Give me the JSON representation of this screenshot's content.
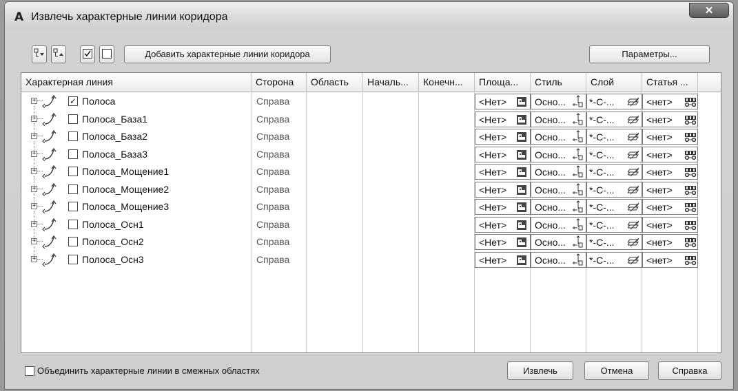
{
  "window": {
    "title": "Извлечь характерные линии коридора",
    "close_glyph": "✕"
  },
  "toolbar": {
    "add_label": "Добавить характерные линии коридора",
    "params_label": "Параметры..."
  },
  "columns": [
    "Характерная линия",
    "Сторона",
    "Область",
    "Началь...",
    "Конечн...",
    "Площа...",
    "Стиль",
    "Слой",
    "Статья ..."
  ],
  "rows": [
    {
      "name": "Полоса",
      "side": "Справа",
      "checked": true,
      "area": "<Нет>",
      "style": "Осно...",
      "layer": "*-С-...",
      "article": "<нет>"
    },
    {
      "name": "Полоса_База1",
      "side": "Справа",
      "checked": false,
      "area": "<Нет>",
      "style": "Осно...",
      "layer": "*-С-...",
      "article": "<нет>"
    },
    {
      "name": "Полоса_База2",
      "side": "Справа",
      "checked": false,
      "area": "<Нет>",
      "style": "Осно...",
      "layer": "*-С-...",
      "article": "<нет>"
    },
    {
      "name": "Полоса_База3",
      "side": "Справа",
      "checked": false,
      "area": "<Нет>",
      "style": "Осно...",
      "layer": "*-С-...",
      "article": "<нет>"
    },
    {
      "name": "Полоса_Мощение1",
      "side": "Справа",
      "checked": false,
      "area": "<Нет>",
      "style": "Осно...",
      "layer": "*-С-...",
      "article": "<нет>"
    },
    {
      "name": "Полоса_Мощение2",
      "side": "Справа",
      "checked": false,
      "area": "<Нет>",
      "style": "Осно...",
      "layer": "*-С-...",
      "article": "<нет>"
    },
    {
      "name": "Полоса_Мощение3",
      "side": "Справа",
      "checked": false,
      "area": "<Нет>",
      "style": "Осно...",
      "layer": "*-С-...",
      "article": "<нет>"
    },
    {
      "name": "Полоса_Осн1",
      "side": "Справа",
      "checked": false,
      "area": "<Нет>",
      "style": "Осно...",
      "layer": "*-С-...",
      "article": "<нет>"
    },
    {
      "name": "Полоса_Осн2",
      "side": "Справа",
      "checked": false,
      "area": "<Нет>",
      "style": "Осно...",
      "layer": "*-С-...",
      "article": "<нет>"
    },
    {
      "name": "Полоса_Осн3",
      "side": "Справа",
      "checked": false,
      "area": "<Нет>",
      "style": "Осно...",
      "layer": "*-С-...",
      "article": "<нет>"
    }
  ],
  "footer": {
    "merge_label": "Объединить характерные линии в смежных областях",
    "merge_checked": false,
    "extract_label": "Извлечь",
    "cancel_label": "Отмена",
    "help_label": "Справка"
  }
}
